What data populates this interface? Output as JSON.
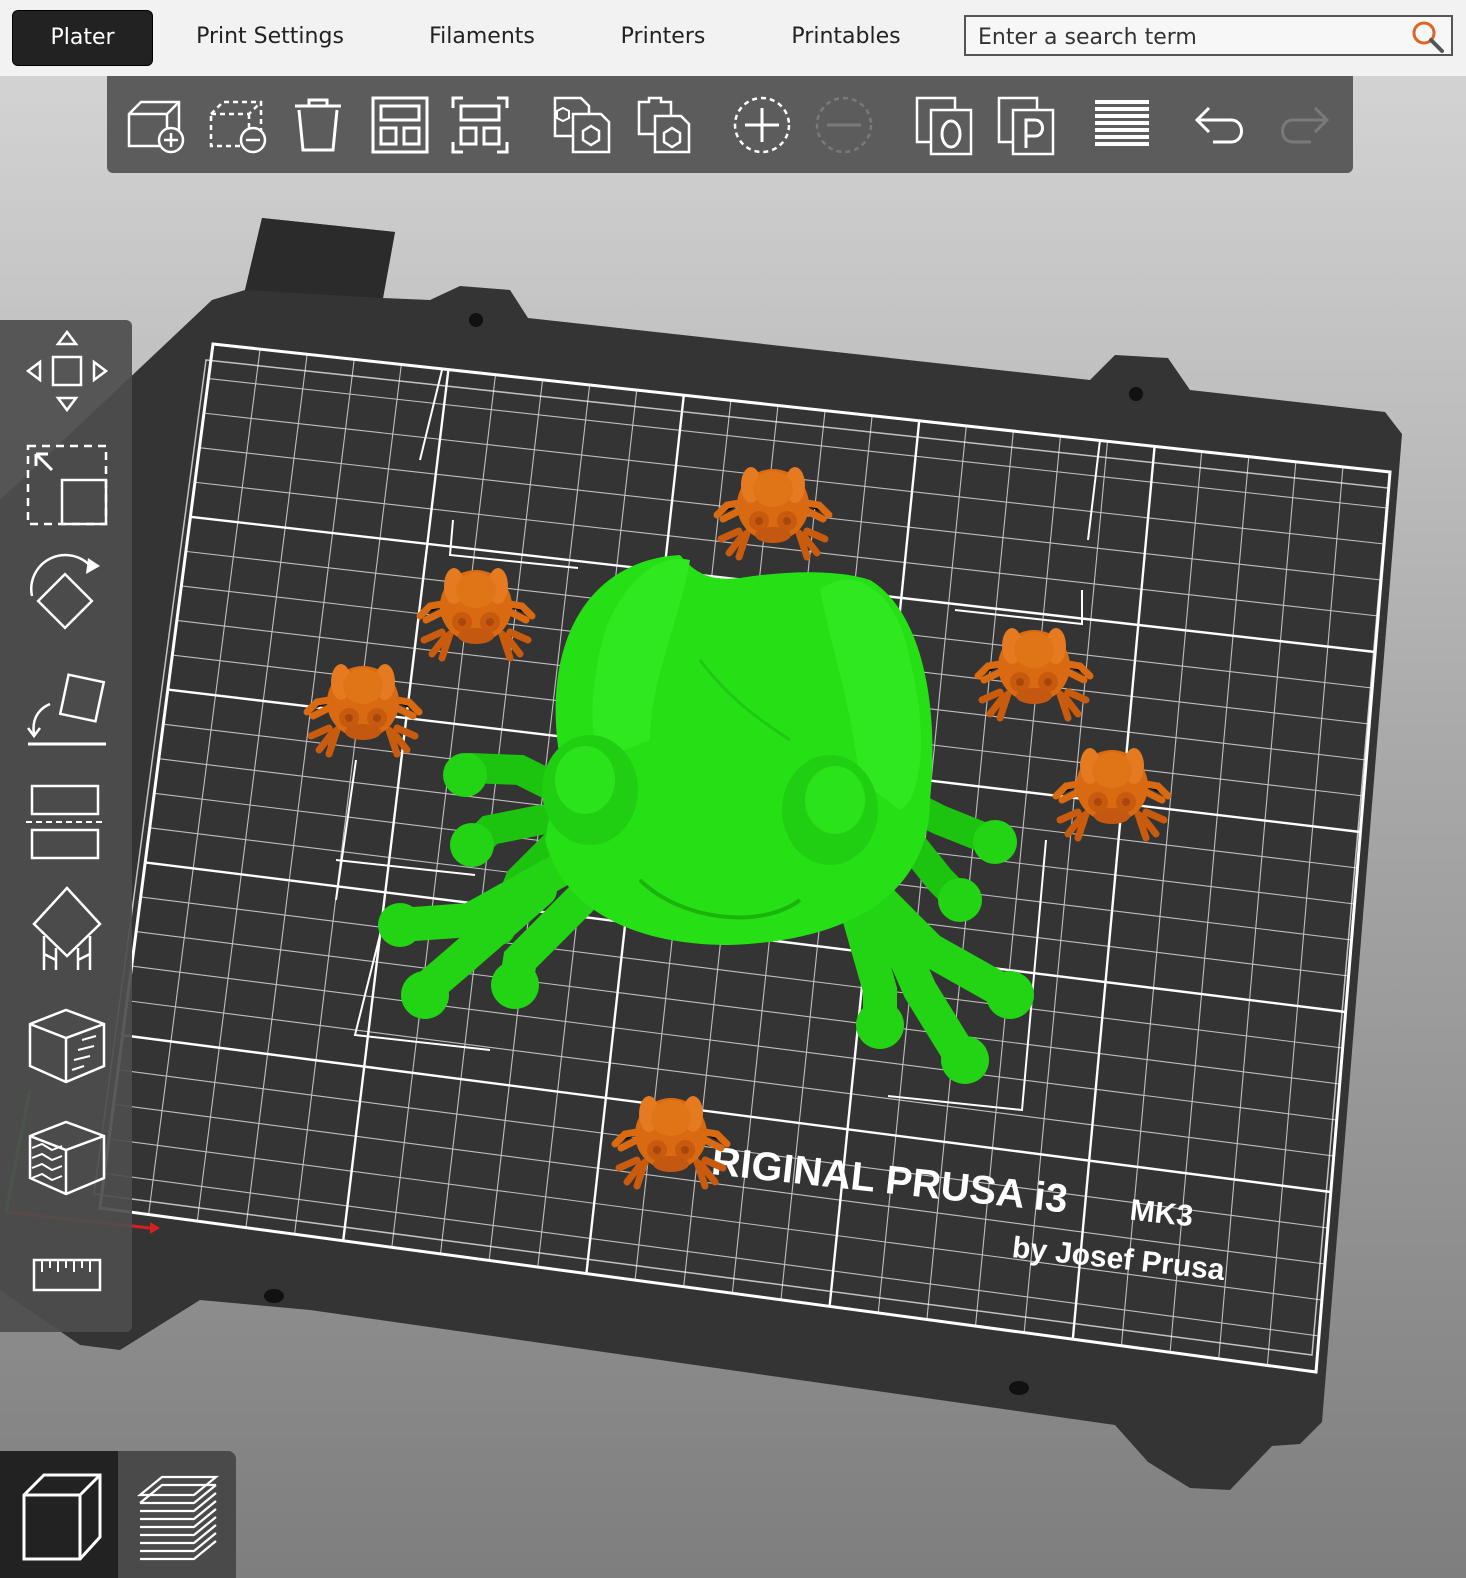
{
  "tabs": [
    {
      "label": "Plater",
      "active": true
    },
    {
      "label": "Print Settings"
    },
    {
      "label": "Filaments"
    },
    {
      "label": "Printers"
    },
    {
      "label": "Printables"
    }
  ],
  "search": {
    "placeholder": "Enter a search term",
    "icon": "magnifier-icon"
  },
  "toolbar": {
    "icons": [
      "add-object-icon",
      "delete-selection-icon",
      "delete-all-icon",
      "arrange-icon",
      "arrange-selection-icon",
      "copy-icon",
      "paste-icon",
      "add-instance-icon",
      "remove-instance-icon",
      "split-objects-icon",
      "split-parts-icon",
      "layer-editing-icon",
      "undo-icon",
      "redo-icon"
    ]
  },
  "sidebar": {
    "icons": [
      "move-icon",
      "scale-icon",
      "rotate-icon",
      "place-on-face-icon",
      "cut-icon",
      "supports-paint-icon",
      "seam-paint-icon",
      "multimaterial-paint-icon",
      "measure-icon"
    ]
  },
  "bed": {
    "line1": "RIGINAL PRUSA i3",
    "line1b": "MK3",
    "line2": "by Josef Prusa"
  },
  "views": [
    {
      "name": "3d-view",
      "selected": true
    },
    {
      "name": "preview"
    }
  ],
  "colors": {
    "main_object": "#22dd11",
    "instances": "#d96a12",
    "bed": "#343434",
    "grid": "#ffffff"
  }
}
